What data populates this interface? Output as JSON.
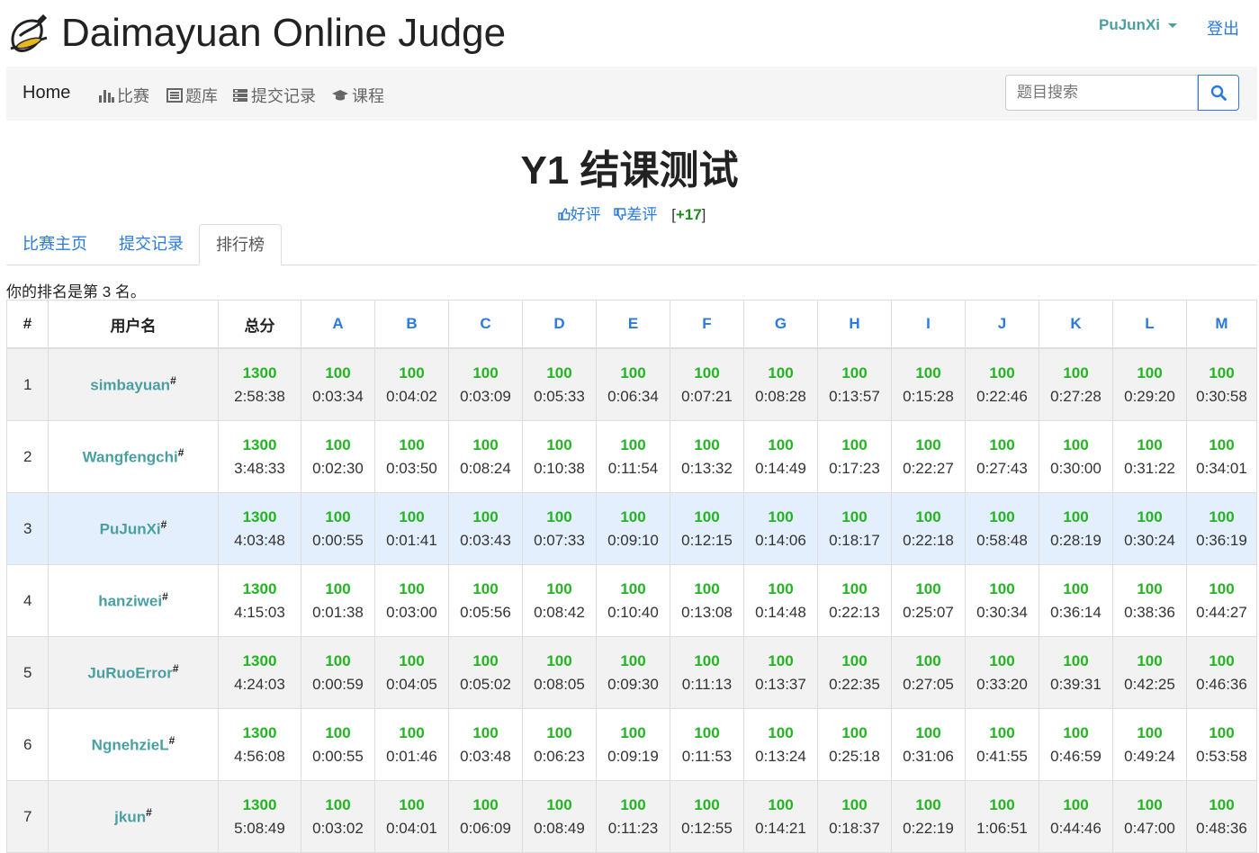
{
  "site": {
    "title": "Daimayuan Online Judge"
  },
  "user": {
    "name": "PuJunXi",
    "logout": "登出"
  },
  "nav": {
    "home": "Home",
    "items": [
      {
        "label": "比赛",
        "icon": "bar-chart-icon"
      },
      {
        "label": "题库",
        "icon": "list-icon"
      },
      {
        "label": "提交记录",
        "icon": "tasks-icon"
      },
      {
        "label": "课程",
        "icon": "graduation-cap-icon"
      }
    ],
    "search_placeholder": "题目搜索"
  },
  "contest": {
    "title": "Y1 结课测试",
    "like": "好评",
    "dislike": "差评",
    "score_prefix": "[",
    "score": "+17",
    "score_suffix": "]"
  },
  "tabs": [
    "比赛主页",
    "提交记录",
    "排行榜"
  ],
  "rank_text": "你的排名是第 3 名。",
  "table": {
    "headers": {
      "rank": "#",
      "user": "用户名",
      "total": "总分"
    },
    "problems": [
      "A",
      "B",
      "C",
      "D",
      "E",
      "F",
      "G",
      "H",
      "I",
      "J",
      "K",
      "L",
      "M"
    ],
    "rows": [
      {
        "rank": "1",
        "user": "simbayuan",
        "mark": "#",
        "total": "1300",
        "total_time": "2:58:38",
        "cells": [
          {
            "s": "100",
            "t": "0:03:34"
          },
          {
            "s": "100",
            "t": "0:04:02"
          },
          {
            "s": "100",
            "t": "0:03:09"
          },
          {
            "s": "100",
            "t": "0:05:33"
          },
          {
            "s": "100",
            "t": "0:06:34"
          },
          {
            "s": "100",
            "t": "0:07:21"
          },
          {
            "s": "100",
            "t": "0:08:28"
          },
          {
            "s": "100",
            "t": "0:13:57"
          },
          {
            "s": "100",
            "t": "0:15:28"
          },
          {
            "s": "100",
            "t": "0:22:46"
          },
          {
            "s": "100",
            "t": "0:27:28"
          },
          {
            "s": "100",
            "t": "0:29:20"
          },
          {
            "s": "100",
            "t": "0:30:58"
          }
        ]
      },
      {
        "rank": "2",
        "user": "Wangfengchi",
        "mark": "#",
        "total": "1300",
        "total_time": "3:48:33",
        "cells": [
          {
            "s": "100",
            "t": "0:02:30"
          },
          {
            "s": "100",
            "t": "0:03:50"
          },
          {
            "s": "100",
            "t": "0:08:24"
          },
          {
            "s": "100",
            "t": "0:10:38"
          },
          {
            "s": "100",
            "t": "0:11:54"
          },
          {
            "s": "100",
            "t": "0:13:32"
          },
          {
            "s": "100",
            "t": "0:14:49"
          },
          {
            "s": "100",
            "t": "0:17:23"
          },
          {
            "s": "100",
            "t": "0:22:27"
          },
          {
            "s": "100",
            "t": "0:27:43"
          },
          {
            "s": "100",
            "t": "0:30:00"
          },
          {
            "s": "100",
            "t": "0:31:22"
          },
          {
            "s": "100",
            "t": "0:34:01"
          }
        ]
      },
      {
        "rank": "3",
        "user": "PuJunXi",
        "mark": "#",
        "total": "1300",
        "total_time": "4:03:48",
        "cells": [
          {
            "s": "100",
            "t": "0:00:55"
          },
          {
            "s": "100",
            "t": "0:01:41"
          },
          {
            "s": "100",
            "t": "0:03:43"
          },
          {
            "s": "100",
            "t": "0:07:33"
          },
          {
            "s": "100",
            "t": "0:09:10"
          },
          {
            "s": "100",
            "t": "0:12:15"
          },
          {
            "s": "100",
            "t": "0:14:06"
          },
          {
            "s": "100",
            "t": "0:18:17"
          },
          {
            "s": "100",
            "t": "0:22:18"
          },
          {
            "s": "100",
            "t": "0:58:48"
          },
          {
            "s": "100",
            "t": "0:28:19"
          },
          {
            "s": "100",
            "t": "0:30:24"
          },
          {
            "s": "100",
            "t": "0:36:19"
          }
        ]
      },
      {
        "rank": "4",
        "user": "hanziwei",
        "mark": "#",
        "total": "1300",
        "total_time": "4:15:03",
        "cells": [
          {
            "s": "100",
            "t": "0:01:38"
          },
          {
            "s": "100",
            "t": "0:03:00"
          },
          {
            "s": "100",
            "t": "0:05:56"
          },
          {
            "s": "100",
            "t": "0:08:42"
          },
          {
            "s": "100",
            "t": "0:10:40"
          },
          {
            "s": "100",
            "t": "0:13:08"
          },
          {
            "s": "100",
            "t": "0:14:48"
          },
          {
            "s": "100",
            "t": "0:22:13"
          },
          {
            "s": "100",
            "t": "0:25:07"
          },
          {
            "s": "100",
            "t": "0:30:34"
          },
          {
            "s": "100",
            "t": "0:36:14"
          },
          {
            "s": "100",
            "t": "0:38:36"
          },
          {
            "s": "100",
            "t": "0:44:27"
          }
        ]
      },
      {
        "rank": "5",
        "user": "JuRuoError",
        "mark": "#",
        "total": "1300",
        "total_time": "4:24:03",
        "cells": [
          {
            "s": "100",
            "t": "0:00:59"
          },
          {
            "s": "100",
            "t": "0:04:05"
          },
          {
            "s": "100",
            "t": "0:05:02"
          },
          {
            "s": "100",
            "t": "0:08:05"
          },
          {
            "s": "100",
            "t": "0:09:30"
          },
          {
            "s": "100",
            "t": "0:11:13"
          },
          {
            "s": "100",
            "t": "0:13:37"
          },
          {
            "s": "100",
            "t": "0:22:35"
          },
          {
            "s": "100",
            "t": "0:27:05"
          },
          {
            "s": "100",
            "t": "0:33:20"
          },
          {
            "s": "100",
            "t": "0:39:31"
          },
          {
            "s": "100",
            "t": "0:42:25"
          },
          {
            "s": "100",
            "t": "0:46:36"
          }
        ]
      },
      {
        "rank": "6",
        "user": "NgnehzieL",
        "mark": "#",
        "total": "1300",
        "total_time": "4:56:08",
        "cells": [
          {
            "s": "100",
            "t": "0:00:55"
          },
          {
            "s": "100",
            "t": "0:01:46"
          },
          {
            "s": "100",
            "t": "0:03:48"
          },
          {
            "s": "100",
            "t": "0:06:23"
          },
          {
            "s": "100",
            "t": "0:09:19"
          },
          {
            "s": "100",
            "t": "0:11:53"
          },
          {
            "s": "100",
            "t": "0:13:24"
          },
          {
            "s": "100",
            "t": "0:25:18"
          },
          {
            "s": "100",
            "t": "0:31:06"
          },
          {
            "s": "100",
            "t": "0:41:55"
          },
          {
            "s": "100",
            "t": "0:46:59"
          },
          {
            "s": "100",
            "t": "0:49:24"
          },
          {
            "s": "100",
            "t": "0:53:58"
          }
        ]
      },
      {
        "rank": "7",
        "user": "jkun",
        "mark": "#",
        "total": "1300",
        "total_time": "5:08:49",
        "cells": [
          {
            "s": "100",
            "t": "0:03:02"
          },
          {
            "s": "100",
            "t": "0:04:01"
          },
          {
            "s": "100",
            "t": "0:06:09"
          },
          {
            "s": "100",
            "t": "0:08:49"
          },
          {
            "s": "100",
            "t": "0:11:23"
          },
          {
            "s": "100",
            "t": "0:12:55"
          },
          {
            "s": "100",
            "t": "0:14:21"
          },
          {
            "s": "100",
            "t": "0:18:37"
          },
          {
            "s": "100",
            "t": "0:22:19"
          },
          {
            "s": "100",
            "t": "1:06:51"
          },
          {
            "s": "100",
            "t": "0:44:46"
          },
          {
            "s": "100",
            "t": "0:47:00"
          },
          {
            "s": "100",
            "t": "0:48:36"
          }
        ]
      }
    ]
  }
}
